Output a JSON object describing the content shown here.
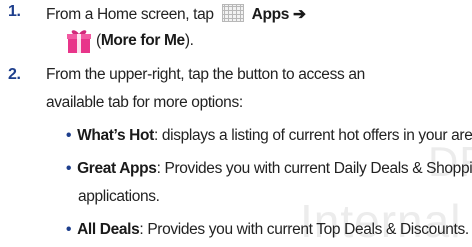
{
  "watermark": {
    "top": "DR",
    "bottom": "Internal"
  },
  "step1": {
    "number": "1.",
    "prefix": "From a Home screen, tap",
    "apps_label": "Apps",
    "arrow": "➔",
    "open_paren": "(",
    "more_for_me": "More for Me",
    "close": ")."
  },
  "step2": {
    "number": "2.",
    "line1": "From the upper-right, tap the button to access an",
    "line2": "available tab for more options:",
    "bullets": [
      {
        "title": "What’s Hot",
        "text": ": displays a listing of current hot offers in your area."
      },
      {
        "title": "Great Apps",
        "text": ": Provides you with current Daily Deals & Shopping"
      },
      {
        "cont": "applications."
      },
      {
        "title": "All Deals",
        "text": ": Provides you with current Top Deals & Discounts."
      }
    ]
  },
  "icons": {
    "apps": "apps-grid-icon",
    "more_for_me": "gift-icon",
    "gift_color": "#e8358a"
  }
}
